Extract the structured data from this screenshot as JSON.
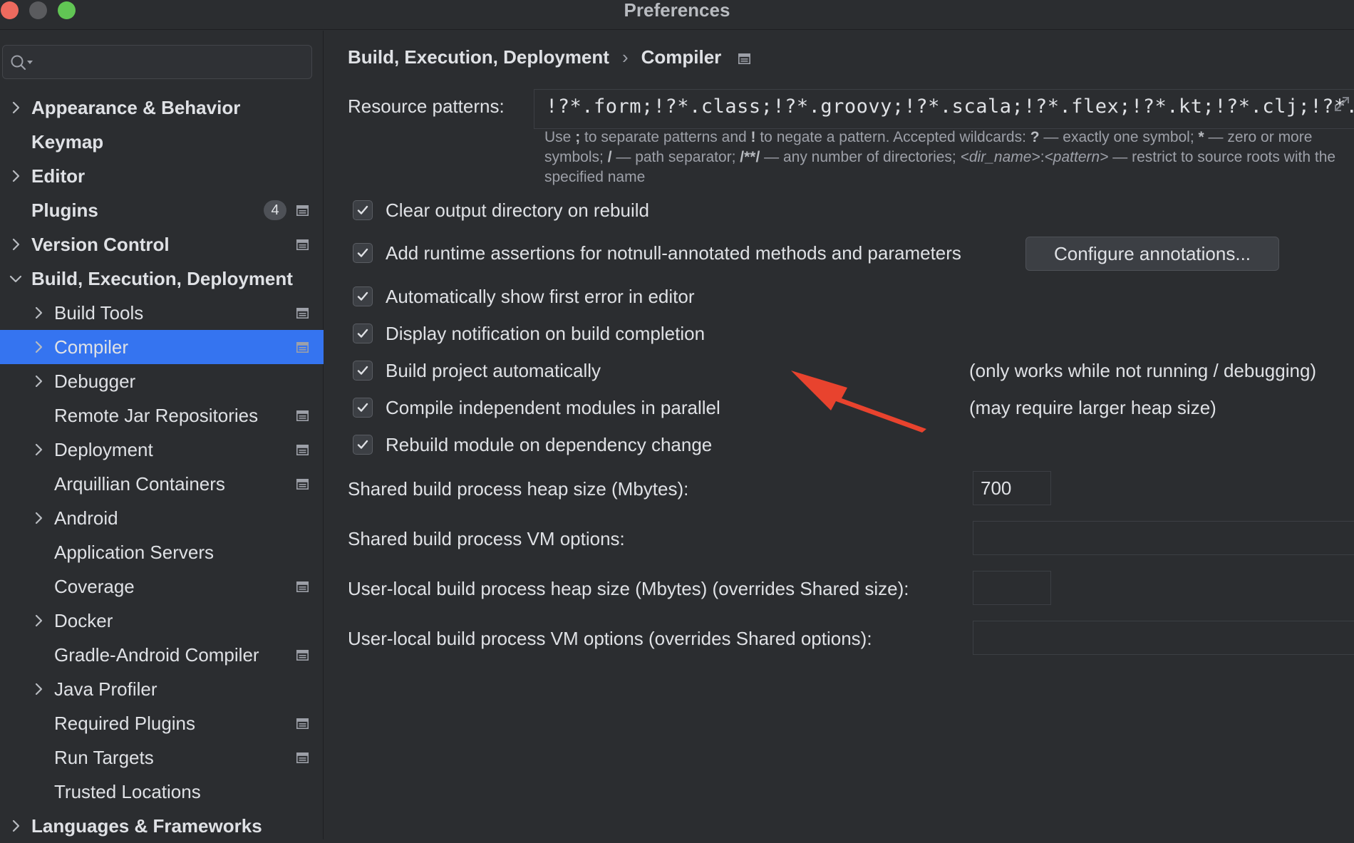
{
  "window": {
    "title": "Preferences"
  },
  "sidebar": {
    "search_placeholder": "",
    "items": [
      {
        "label": "Appearance & Behavior",
        "level": "top",
        "expandable": true,
        "expanded": false
      },
      {
        "label": "Keymap",
        "level": "top",
        "expandable": false
      },
      {
        "label": "Editor",
        "level": "top",
        "expandable": true,
        "expanded": false
      },
      {
        "label": "Plugins",
        "level": "top",
        "expandable": false,
        "badge": "4",
        "project_icon": true
      },
      {
        "label": "Version Control",
        "level": "top",
        "expandable": true,
        "expanded": false,
        "project_icon": true
      },
      {
        "label": "Build, Execution, Deployment",
        "level": "top",
        "expandable": true,
        "expanded": true
      },
      {
        "label": "Build Tools",
        "level": "child",
        "expandable": true,
        "project_icon": true
      },
      {
        "label": "Compiler",
        "level": "child",
        "expandable": true,
        "project_icon": true,
        "selected": true
      },
      {
        "label": "Debugger",
        "level": "child",
        "expandable": true
      },
      {
        "label": "Remote Jar Repositories",
        "level": "child",
        "expandable": false,
        "project_icon": true
      },
      {
        "label": "Deployment",
        "level": "child",
        "expandable": true,
        "project_icon": true
      },
      {
        "label": "Arquillian Containers",
        "level": "child",
        "expandable": false,
        "project_icon": true
      },
      {
        "label": "Android",
        "level": "child",
        "expandable": true
      },
      {
        "label": "Application Servers",
        "level": "child",
        "expandable": false
      },
      {
        "label": "Coverage",
        "level": "child",
        "expandable": false,
        "project_icon": true
      },
      {
        "label": "Docker",
        "level": "child",
        "expandable": true
      },
      {
        "label": "Gradle-Android Compiler",
        "level": "child",
        "expandable": false,
        "project_icon": true
      },
      {
        "label": "Java Profiler",
        "level": "child",
        "expandable": true
      },
      {
        "label": "Required Plugins",
        "level": "child",
        "expandable": false,
        "project_icon": true
      },
      {
        "label": "Run Targets",
        "level": "child",
        "expandable": false,
        "project_icon": true
      },
      {
        "label": "Trusted Locations",
        "level": "child",
        "expandable": false
      },
      {
        "label": "Languages & Frameworks",
        "level": "top",
        "expandable": true,
        "expanded": false
      }
    ]
  },
  "main": {
    "breadcrumb": [
      "Build, Execution, Deployment",
      "Compiler"
    ],
    "breadcrumb_separator": "›",
    "resource_patterns": {
      "label": "Resource patterns:",
      "value": "!?*.form;!?*.class;!?*.groovy;!?*.scala;!?*.flex;!?*.kt;!?*.clj;!?*.aj",
      "hint_parts": {
        "p1": "Use ",
        "semicolon": ";",
        "p2": " to separate patterns and ",
        "bang": "!",
        "p3": " to negate a pattern. Accepted wildcards: ",
        "q": "?",
        "p4": " — exactly one symbol; ",
        "star": "*",
        "p5": " — zero or more symbols; ",
        "slash": "/",
        "p6": " — path separator; ",
        "dstar": "/**/",
        "p7": " — any number of directories; ",
        "dir": "<dir_name>",
        "colon": ":",
        "pat": "<pattern>",
        "p8": " — restrict to source roots with the specified name"
      }
    },
    "checkboxes": [
      {
        "label": "Clear output directory on rebuild",
        "checked": true
      },
      {
        "label": "Add runtime assertions for notnull-annotated methods and parameters",
        "checked": true
      },
      {
        "label": "Automatically show first error in editor",
        "checked": true
      },
      {
        "label": "Display notification on build completion",
        "checked": true
      },
      {
        "label": "Build project automatically",
        "checked": true,
        "note": "(only works while not running / debugging)"
      },
      {
        "label": "Compile independent modules in parallel",
        "checked": true,
        "note": "(may require larger heap size)"
      },
      {
        "label": "Rebuild module on dependency change",
        "checked": true
      }
    ],
    "configure_annotations_button": "Configure annotations...",
    "fields": [
      {
        "label": "Shared build process heap size (Mbytes):",
        "value": "700"
      },
      {
        "label": "Shared build process VM options:",
        "value": ""
      },
      {
        "label": "User-local build process heap size (Mbytes) (overrides Shared size):",
        "value": ""
      },
      {
        "label": "User-local build process VM options (overrides Shared options):",
        "value": ""
      }
    ]
  },
  "colors": {
    "background": "#2b2d30",
    "selection": "#3574f0",
    "annotation_arrow": "#e8432e"
  }
}
